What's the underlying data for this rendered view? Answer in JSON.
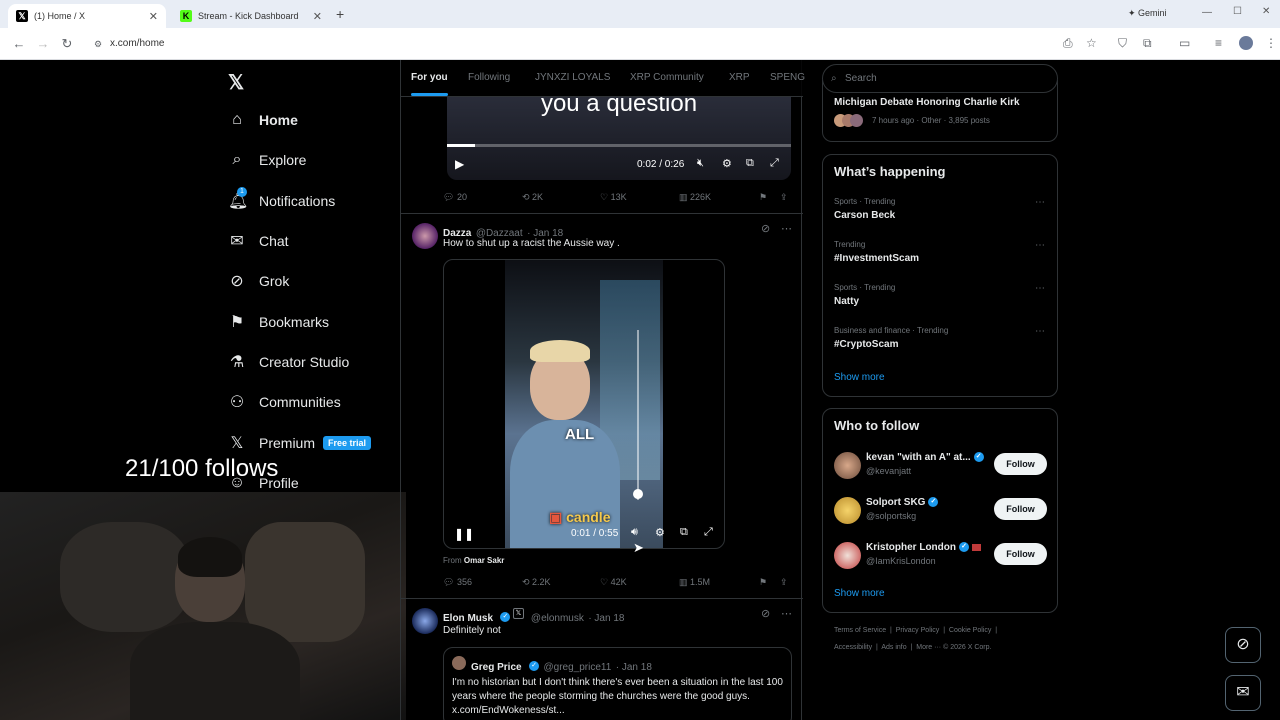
{
  "browser": {
    "tabs": [
      {
        "title": "(1) Home / X",
        "icon": "x-logo"
      },
      {
        "title": "Stream - Kick Dashboard",
        "icon": "kick-logo"
      }
    ],
    "new_tab": "+",
    "gemini": "Gemini",
    "url": "x.com/home"
  },
  "nav": {
    "items": [
      {
        "label": "Home",
        "icon": "home-icon"
      },
      {
        "label": "Explore",
        "icon": "search-icon"
      },
      {
        "label": "Notifications",
        "icon": "bell-icon",
        "count": "1"
      },
      {
        "label": "Chat",
        "icon": "mail-icon"
      },
      {
        "label": "Grok",
        "icon": "grok-icon"
      },
      {
        "label": "Bookmarks",
        "icon": "bookmark-icon"
      },
      {
        "label": "Creator Studio",
        "icon": "creator-icon"
      },
      {
        "label": "Communities",
        "icon": "communities-icon"
      },
      {
        "label": "Premium",
        "icon": "x-icon"
      },
      {
        "label": "Profile",
        "icon": "profile-icon"
      }
    ],
    "premium_badge": "Free trial"
  },
  "overlay": {
    "follows_counter": "21/100 follows"
  },
  "feed_tabs": [
    "For you",
    "Following",
    "JYNXZI LOYALS",
    "XRP Community",
    "XRP",
    "SPENG"
  ],
  "tweet0": {
    "caption": "you a question",
    "time": "0:02 / 0:26",
    "progress": 0.08,
    "replies": "20",
    "reposts": "2K",
    "likes": "13K",
    "views": "226K"
  },
  "tweet1": {
    "name": "Dazza",
    "handle": "@Dazzaat",
    "date": "· Jan 18",
    "text": "How to shut up a racist the Aussie way .",
    "video_caption_1": "ALL",
    "video_caption_2": "candle",
    "time": "0:01 / 0:55",
    "from_label": "From",
    "from_name": "Omar Sakr",
    "replies": "356",
    "reposts": "2.2K",
    "likes": "42K",
    "views": "1.5M"
  },
  "tweet2": {
    "name": "Elon Musk",
    "handle": "@elonmusk",
    "date": "· Jan 18",
    "text": "Definitely not",
    "quote": {
      "name": "Greg Price",
      "handle": "@greg_price11",
      "date": "· Jan 18",
      "text": "I'm no historian but I don't think there's ever been a situation in the last 100 years where the people storming the churches were the good guys. x.com/EndWokeness/st..."
    }
  },
  "right": {
    "search_placeholder": "Search",
    "top_trend": {
      "title": "Michigan Debate Honoring Charlie Kirk",
      "meta": "7 hours ago · Other · 3,895 posts"
    },
    "happening_title": "What’s happening",
    "trends": [
      {
        "category": "Sports · Trending",
        "name": "Carson Beck"
      },
      {
        "category": "Trending",
        "name": "#InvestmentScam"
      },
      {
        "category": "Sports · Trending",
        "name": "Natty"
      },
      {
        "category": "Business and finance · Trending",
        "name": "#CryptoScam"
      }
    ],
    "show_more": "Show more",
    "who_title": "Who to follow",
    "who": [
      {
        "name": "kevan \"with an A\" at...",
        "handle": "@kevanjatt"
      },
      {
        "name": "Solport SKG",
        "handle": "@solportskg"
      },
      {
        "name": "Kristopher London",
        "handle": "@IamKrisLondon"
      }
    ],
    "follow_label": "Follow",
    "footer_1": [
      "Terms of Service",
      "Privacy Policy",
      "Cookie Policy"
    ],
    "footer_2": [
      "Accessibility",
      "Ads info",
      "More ···",
      "© 2026 X Corp."
    ]
  },
  "colors": {
    "accent": "#1d9bf0",
    "bg": "#000000",
    "border": "#2f3336",
    "muted": "#71767b"
  }
}
